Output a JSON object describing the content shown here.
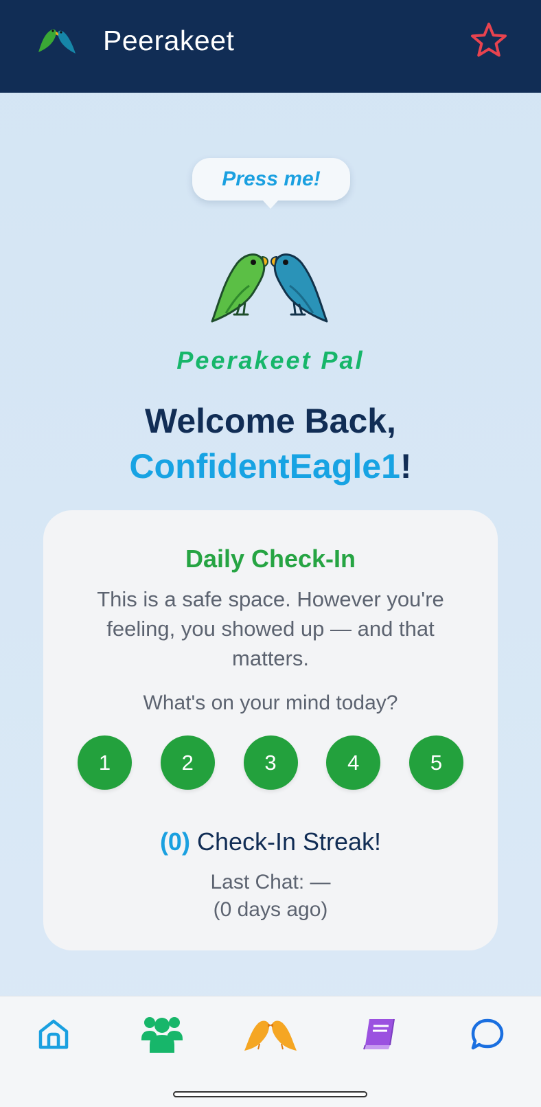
{
  "header": {
    "app_title": "Peerakeet",
    "logo_icon": "parakeets-logo-icon",
    "favorite_icon": "star-outline-icon",
    "colors": {
      "background": "#112d55",
      "star": "#e8434f"
    }
  },
  "mascot": {
    "bubble_text": "Press me!",
    "name": "Peerakeet Pal"
  },
  "welcome": {
    "line1": "Welcome Back,",
    "username": "ConfidentEagle1",
    "suffix": "!"
  },
  "checkin": {
    "title": "Daily Check-In",
    "message": "This is a safe space. However you're feeling, you showed up — and that matters.",
    "question": "What's on your mind today?",
    "ratings": [
      "1",
      "2",
      "3",
      "4",
      "5"
    ],
    "streak_count": "(0)",
    "streak_label": " Check-In Streak!",
    "last_chat_line1": "Last Chat: —",
    "last_chat_line2": "(0 days ago)"
  },
  "nav": {
    "items": [
      {
        "icon": "home-icon",
        "color": "#1aa0e0"
      },
      {
        "icon": "community-icon",
        "color": "#17b66a"
      },
      {
        "icon": "parakeets-icon",
        "color": "#f5a623"
      },
      {
        "icon": "journal-icon",
        "color": "#9b51e0"
      },
      {
        "icon": "chat-icon",
        "color": "#1a6fe0"
      }
    ]
  }
}
